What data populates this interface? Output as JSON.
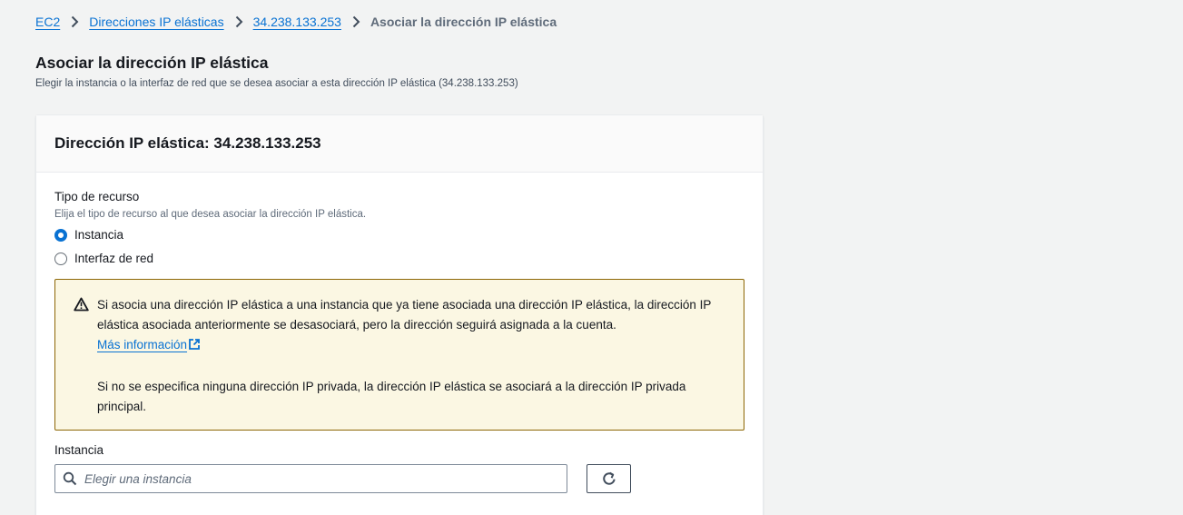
{
  "breadcrumb": {
    "items": [
      {
        "label": "EC2"
      },
      {
        "label": "Direcciones IP elásticas"
      },
      {
        "label": "34.238.133.253"
      }
    ],
    "current": "Asociar la dirección IP elástica"
  },
  "page": {
    "title": "Asociar la dirección IP elástica",
    "description": "Elegir la instancia o la interfaz de red que se desea asociar a esta dirección IP elástica (34.238.133.253)"
  },
  "container": {
    "title": "Dirección IP elástica: 34.238.133.253"
  },
  "resource_type": {
    "label": "Tipo de recurso",
    "description": "Elija el tipo de recurso al que desea asociar la dirección IP elástica.",
    "options": [
      {
        "label": "Instancia",
        "selected": true
      },
      {
        "label": "Interfaz de red",
        "selected": false
      }
    ]
  },
  "alert": {
    "type": "warning",
    "line1": "Si asocia una dirección IP elástica a una instancia que ya tiene asociada una dirección IP elástica, la dirección IP elástica asociada anteriormente se desasociará, pero la dirección seguirá asignada a la cuenta.",
    "link_label": "Más información",
    "line2": "Si no se especifica ninguna dirección IP privada, la dirección IP elástica se asociará a la dirección IP privada principal."
  },
  "instance": {
    "label": "Instancia",
    "placeholder": "Elegir una instancia"
  },
  "icons": {
    "breadcrumb_separator": "chevron-right-icon",
    "warning": "warning-icon",
    "external": "external-link-icon",
    "search": "search-icon",
    "refresh": "refresh-icon"
  },
  "colors": {
    "link": "#0972d3",
    "warning_border": "#8d6605",
    "warning_bg": "#fbf7e3",
    "page_bg": "#f2f3f3",
    "selected_radio": "#0972d3"
  }
}
